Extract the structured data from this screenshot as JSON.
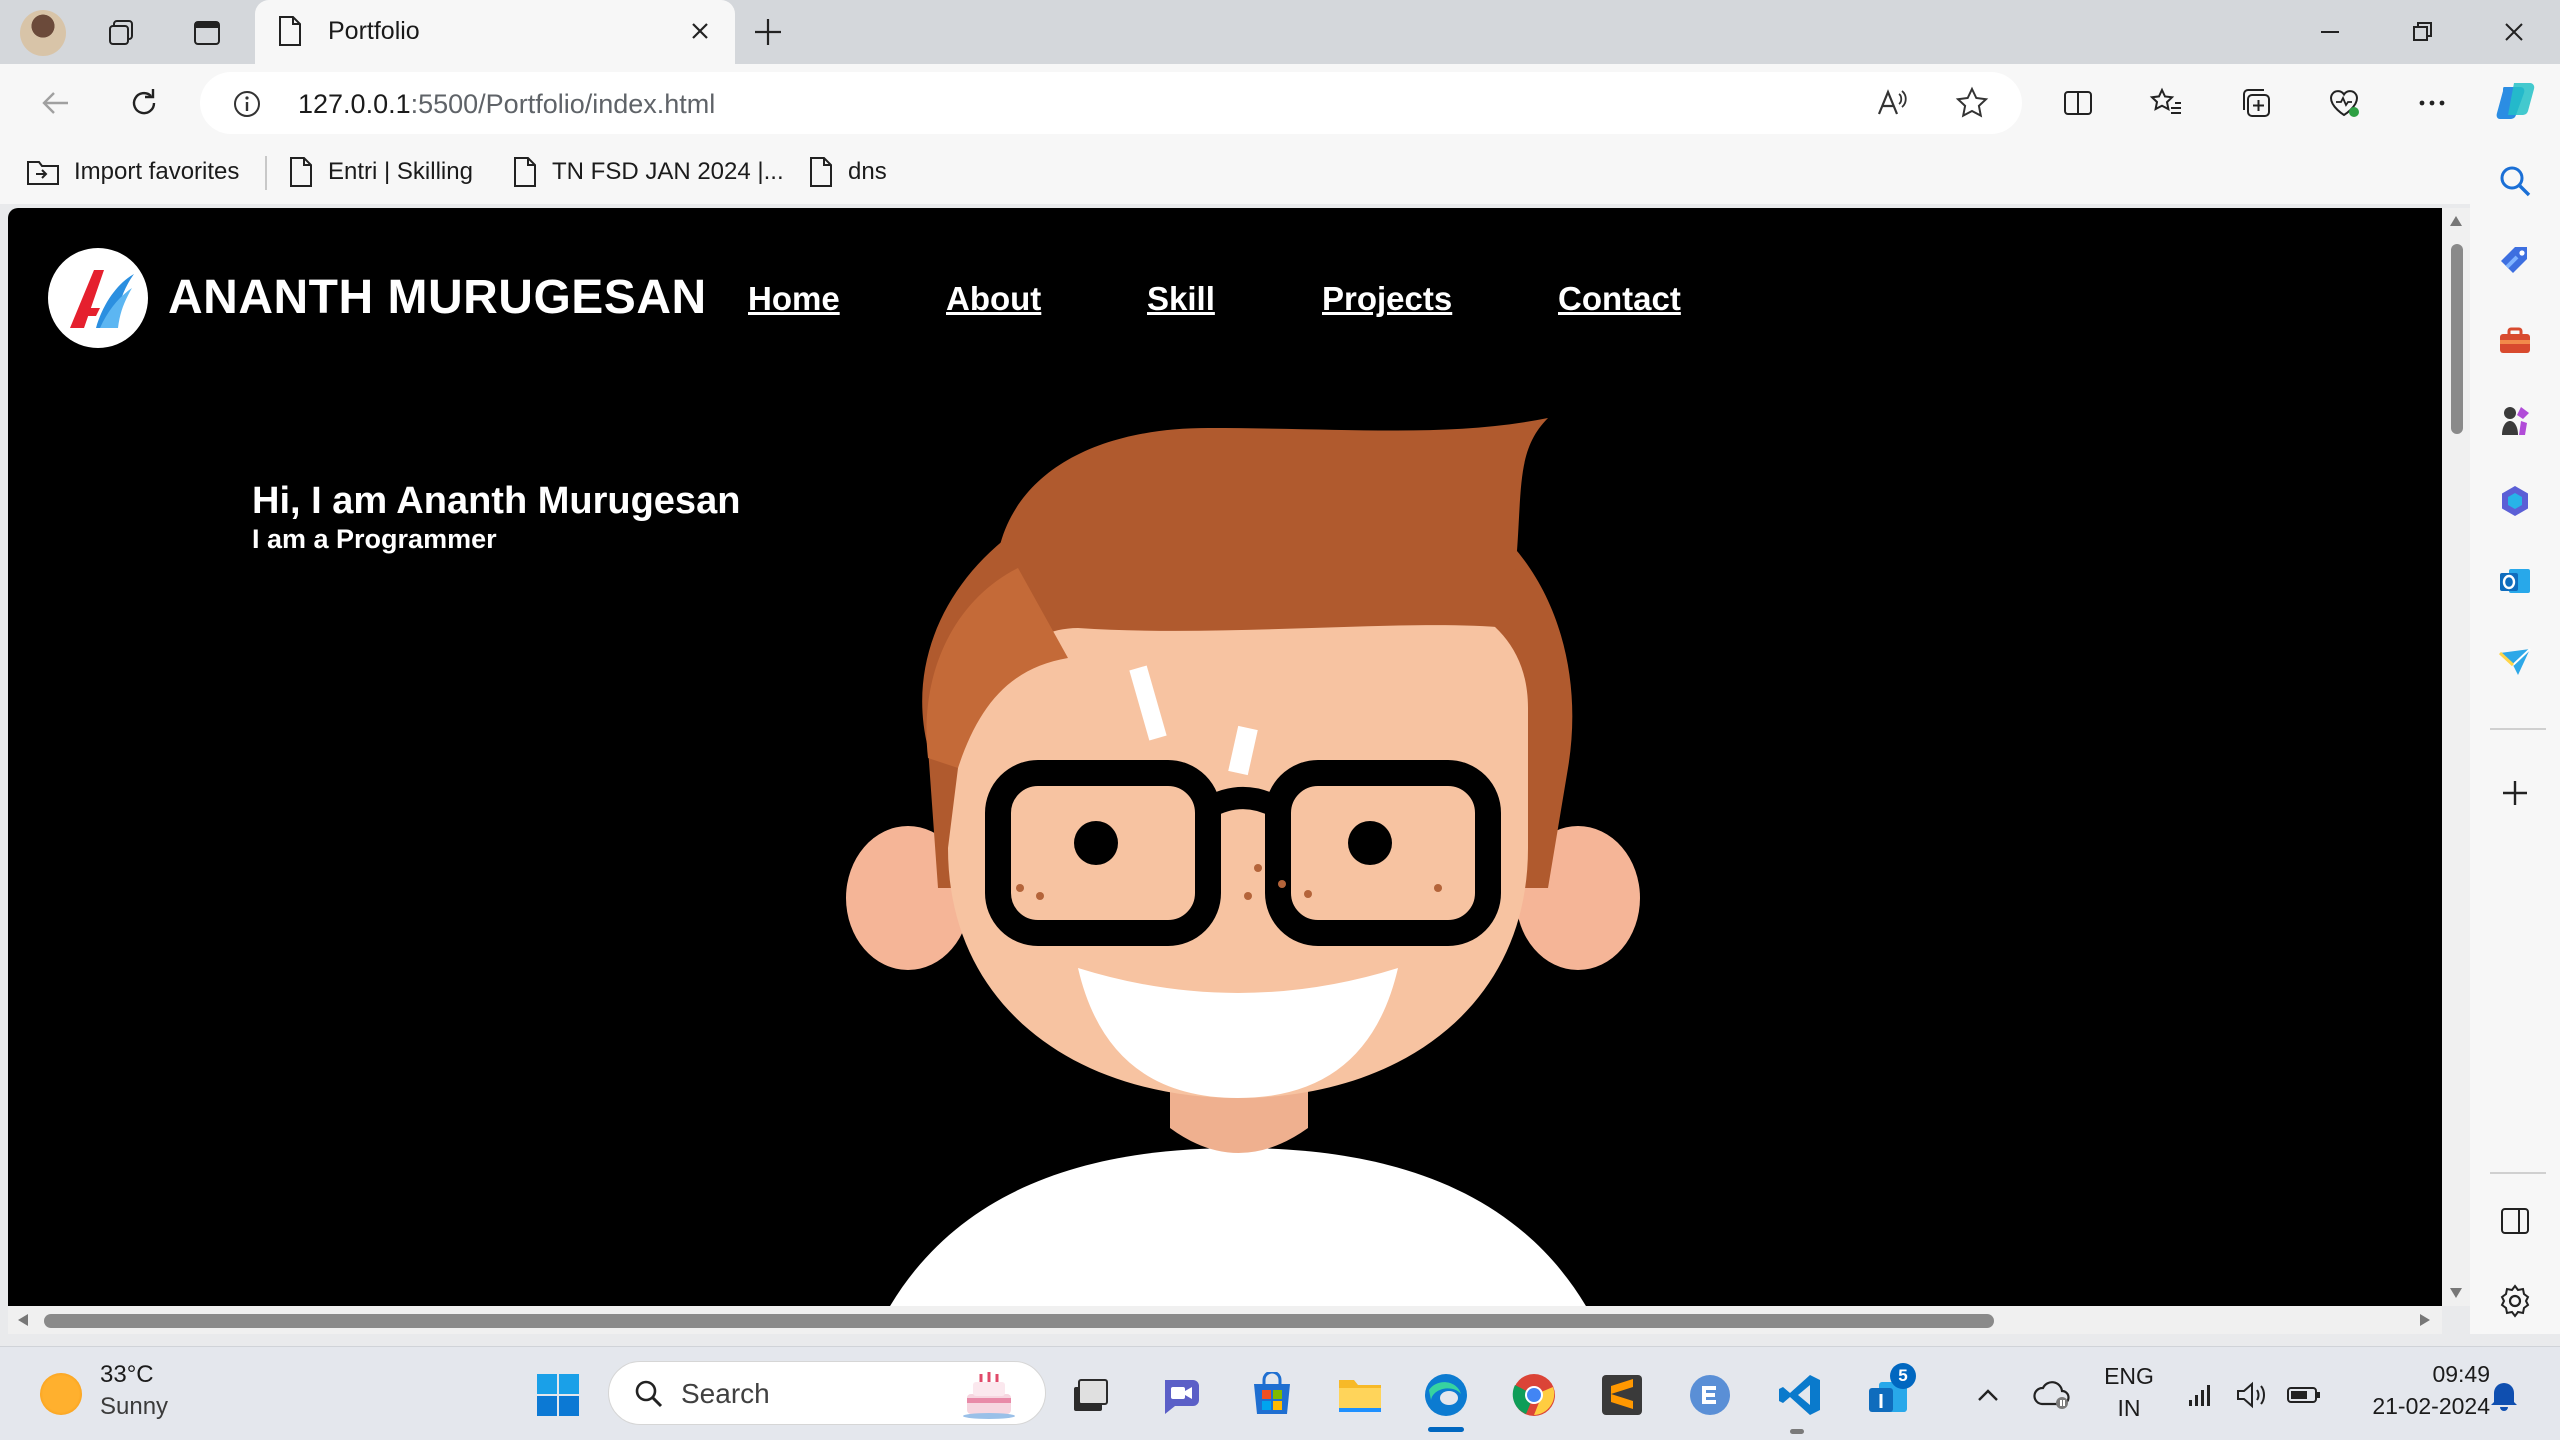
{
  "browser": {
    "tab_title": "Portfolio",
    "url_host": "127.0.0.1",
    "url_path": ":5500/Portfolio/index.html",
    "favorites": [
      {
        "label": "Import favorites"
      },
      {
        "label": "Entri | Skilling"
      },
      {
        "label": "TN FSD JAN 2024 |..."
      },
      {
        "label": "dns"
      }
    ]
  },
  "page": {
    "brand": "ANANTH MURUGESAN",
    "nav": [
      "Home",
      "About",
      "Skill",
      "Projects",
      "Contact"
    ],
    "hero_title": "Hi, I am Ananth Murugesan",
    "hero_subtitle": "I am a Programmer"
  },
  "taskbar": {
    "weather_temp": "33°C",
    "weather_desc": "Sunny",
    "search_label": "Search",
    "lang_top": "ENG",
    "lang_bottom": "IN",
    "time": "09:49",
    "date": "21-02-2024",
    "notification_count": "5"
  },
  "colors": {
    "page_bg": "#000000",
    "hair": "#b05a2e",
    "skin": "#f7c3a1",
    "accent": "#0067c0"
  }
}
